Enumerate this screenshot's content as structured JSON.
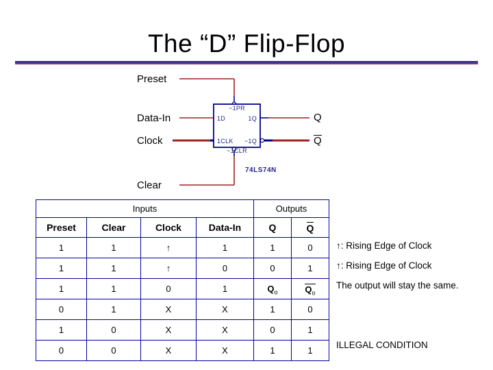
{
  "slide": {
    "title": "The “D” Flip-Flop",
    "rule_colors": {
      "top": "#33348e",
      "bottom": "#993366"
    }
  },
  "circuit": {
    "input_labels": [
      {
        "name": "preset",
        "text": "Preset"
      },
      {
        "name": "data-in",
        "text": "Data-In"
      },
      {
        "name": "clock",
        "text": "Clock"
      },
      {
        "name": "clear",
        "text": "Clear"
      }
    ],
    "output_labels": [
      {
        "name": "q",
        "text": "Q",
        "overbar": false
      },
      {
        "name": "q-bar",
        "text": "Q",
        "overbar": true
      }
    ],
    "chip": {
      "part_number": "74LS74N",
      "pin_preset": "~1PR",
      "pin_data": "1D",
      "pin_clock": "1CLK",
      "pin_clear": "~1CLR",
      "pin_q": "1Q",
      "pin_qbar": "~1Q",
      "outline_color": "#00008b",
      "wire_red": "#a02020",
      "wire_blue": "#00008b"
    }
  },
  "table": {
    "border_color": "#0000a0",
    "group_headers": [
      {
        "label": "Inputs",
        "span": 4
      },
      {
        "label": "Outputs",
        "span": 2
      }
    ],
    "columns": [
      {
        "key": "preset",
        "label": "Preset",
        "overbar": false
      },
      {
        "key": "clear",
        "label": "Clear",
        "overbar": false
      },
      {
        "key": "clock",
        "label": "Clock",
        "overbar": false
      },
      {
        "key": "data_in",
        "label": "Data-In",
        "overbar": false
      },
      {
        "key": "q",
        "label": "Q",
        "overbar": false
      },
      {
        "key": "q_bar",
        "label": "Q",
        "overbar": true
      }
    ],
    "rows": [
      {
        "preset": "1",
        "clear": "1",
        "clock": "↑",
        "data_in": "1",
        "q": "1",
        "q_sub": "",
        "q_bar": "0",
        "q_bar_sub": "",
        "q_bar_overbar": false,
        "note": "↑: Rising Edge of Clock"
      },
      {
        "preset": "1",
        "clear": "1",
        "clock": "↑",
        "data_in": "0",
        "q": "0",
        "q_sub": "",
        "q_bar": "1",
        "q_bar_sub": "",
        "q_bar_overbar": false,
        "note": "↑: Rising Edge of Clock"
      },
      {
        "preset": "1",
        "clear": "1",
        "clock": "0",
        "data_in": "1",
        "q": "Q",
        "q_sub": "o",
        "q_bar": "Q",
        "q_bar_sub": "o",
        "q_bar_overbar": true,
        "note": "The output will stay the same."
      },
      {
        "preset": "0",
        "clear": "1",
        "clock": "X",
        "data_in": "X",
        "q": "1",
        "q_sub": "",
        "q_bar": "0",
        "q_bar_sub": "",
        "q_bar_overbar": false,
        "note": ""
      },
      {
        "preset": "1",
        "clear": "0",
        "clock": "X",
        "data_in": "X",
        "q": "0",
        "q_sub": "",
        "q_bar": "1",
        "q_bar_sub": "",
        "q_bar_overbar": false,
        "note": ""
      },
      {
        "preset": "0",
        "clear": "0",
        "clock": "X",
        "data_in": "X",
        "q": "1",
        "q_sub": "",
        "q_bar": "1",
        "q_bar_sub": "",
        "q_bar_overbar": false,
        "note": "ILLEGAL CONDITION"
      }
    ]
  }
}
